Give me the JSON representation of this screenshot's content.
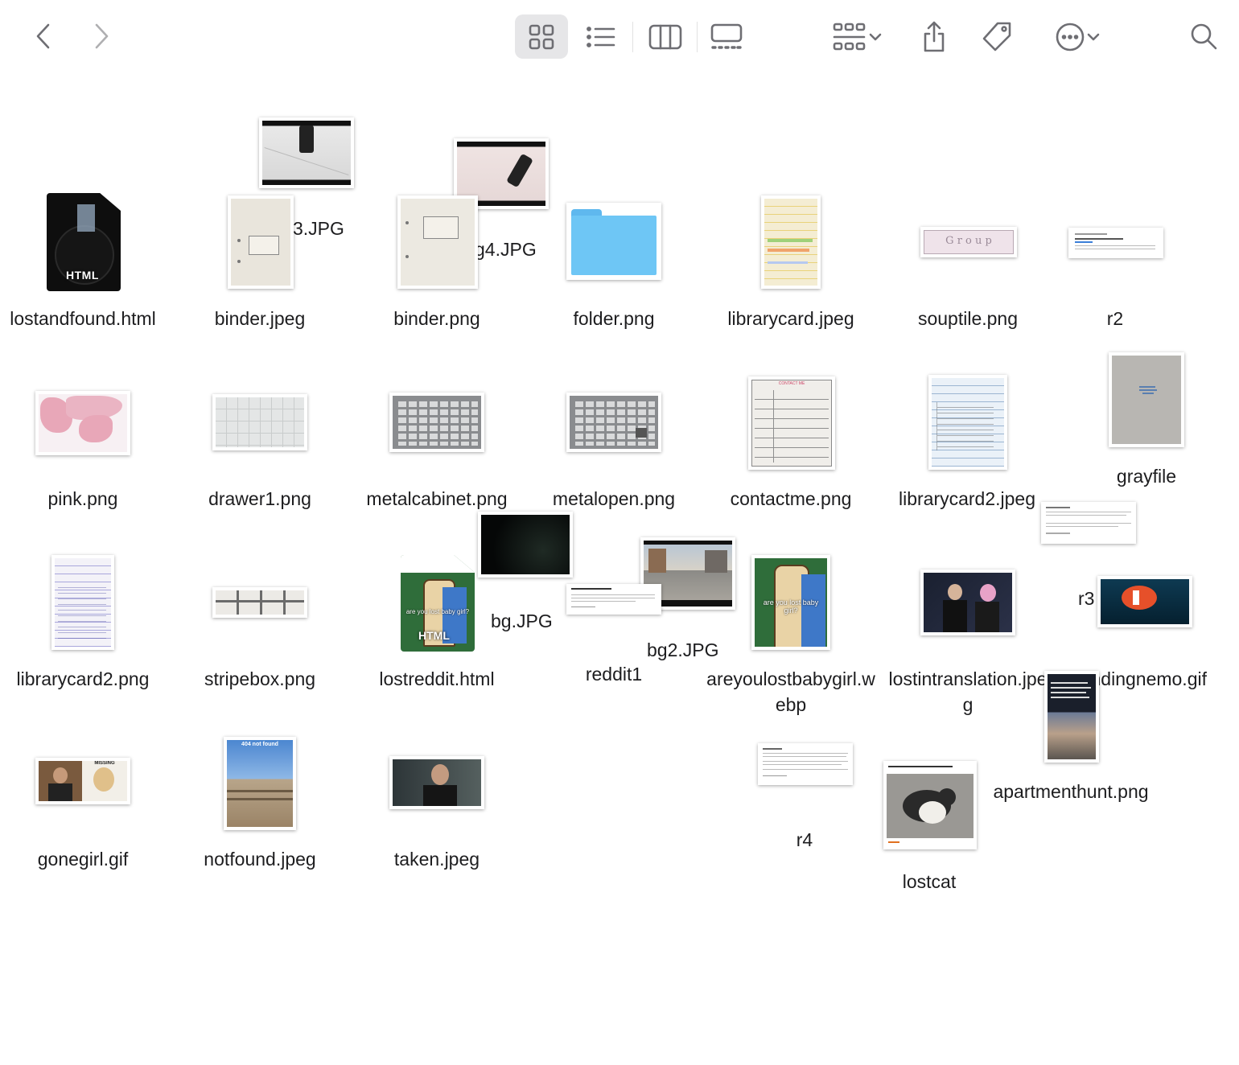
{
  "toolbar": {
    "nav": [
      "back-icon",
      "forward-icon"
    ],
    "view_modes": [
      "icon-view",
      "list-view",
      "column-view",
      "gallery-view"
    ],
    "active_view": "icon-view",
    "controls": [
      "group-icon",
      "share-icon",
      "tag-icon",
      "more-icon",
      "search-icon"
    ]
  },
  "files": {
    "f01": "lostandfound.html",
    "f02": "binder.jpeg",
    "f03": "binder.png",
    "f04": "folder.png",
    "f05": "librarycard.jpeg",
    "f06": "souptile.png",
    "f07": "r2",
    "f08": "3.JPG",
    "f09": "g4.JPG",
    "f10": "pink.png",
    "f11": "drawer1.png",
    "f12": "metalcabinet.png",
    "f13": "metalopen.png",
    "f14": "contactme.png",
    "f15": "librarycard2.jpeg",
    "f16": "grayfile",
    "f17": "librarycard2.png",
    "f18": "stripebox.png",
    "f19": "lostreddit.html",
    "f20": "bg.JPG",
    "f21": "reddit1",
    "f22": "bg2.JPG",
    "f23": "areyoulostbabygirl.webp",
    "f24": "lostintranslation.jpeg",
    "f25": "r3",
    "f26": "findingnemo.gif",
    "f27": "gonegirl.gif",
    "f28": "notfound.jpeg",
    "f29": "taken.jpeg",
    "f30": "r4",
    "f31": "lostcat",
    "f32": "apartmenthunt.png"
  },
  "thumb_text": {
    "html_badge": "HTML",
    "meme_caption": "are you lost baby girl?",
    "notfound_caption": "404 not found",
    "contact_header": "CONTACT ME",
    "souptile_letters": "G  r  o  u  p",
    "gonegirl_banner": "MISSING"
  },
  "colors": {
    "folder_blue": "#6ec6f5",
    "pink": "#e8a7b8",
    "cabinet_gray": "#8a8c8f",
    "selected_toolbar_bg": "#e6e6e8"
  }
}
